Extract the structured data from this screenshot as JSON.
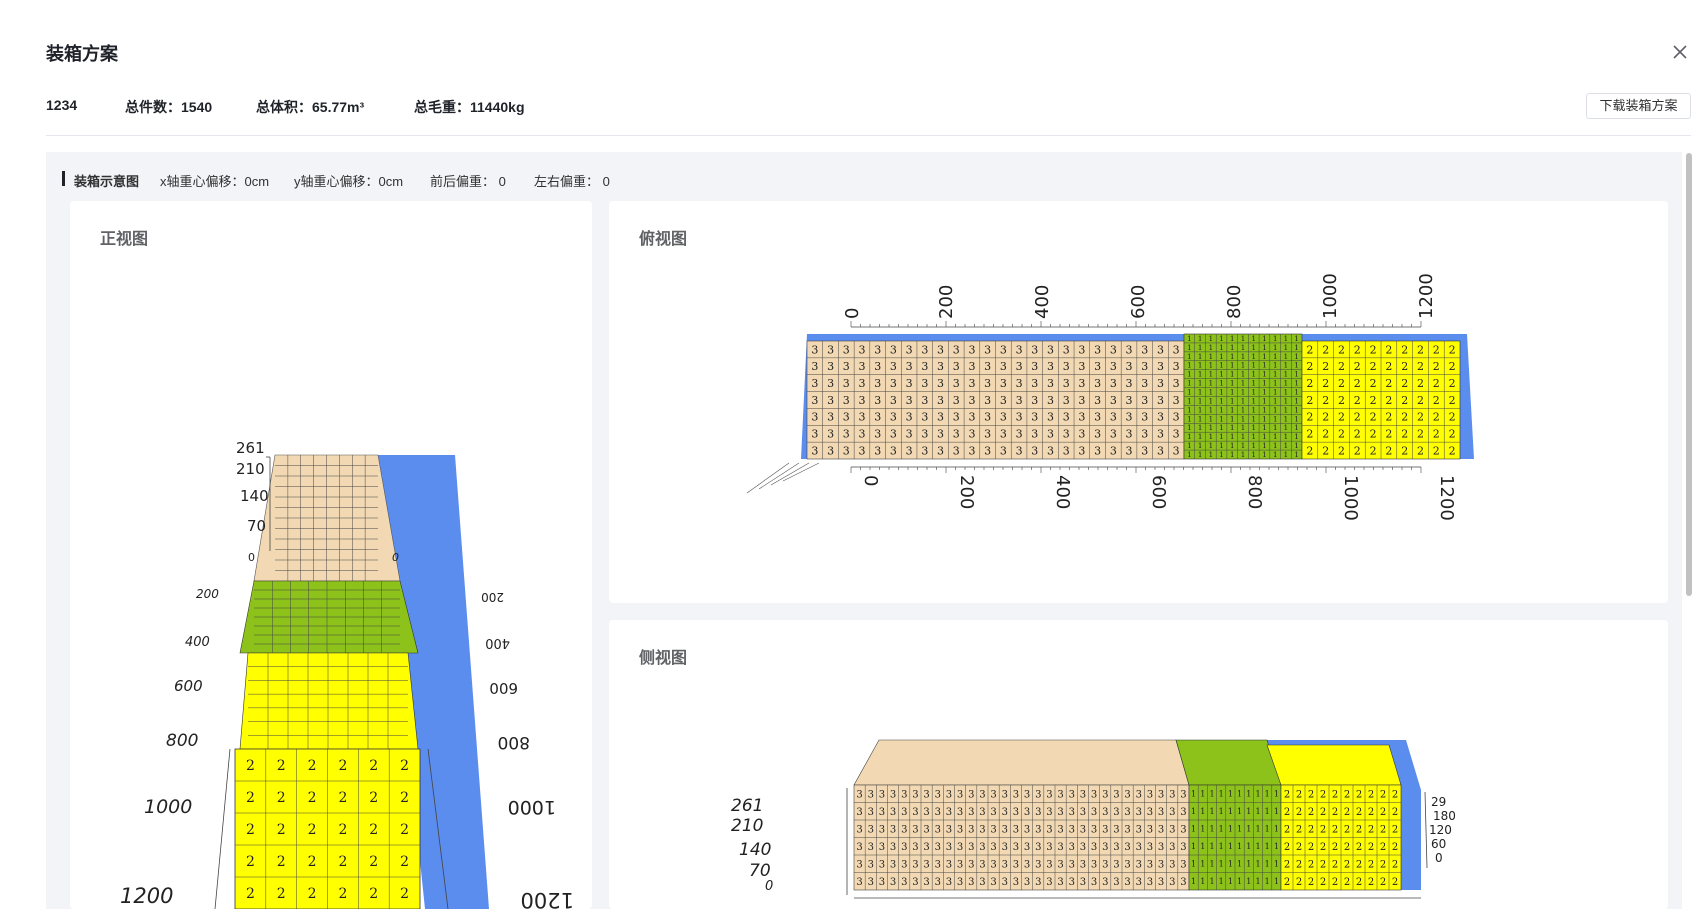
{
  "dialog": {
    "title": "装箱方案",
    "order_no": "1234",
    "total_count": "总件数：1540",
    "total_volume": "总体积：65.77m³",
    "total_weight": "总毛重：11440kg",
    "download_label": "下载装箱方案"
  },
  "diagram": {
    "heading": "装箱示意图",
    "x_offset": "x轴重心偏移：0cm",
    "y_offset": "y轴重心偏移：0cm",
    "front_back": "前后偏重：  0",
    "left_right": "左右偏重：  0"
  },
  "views": {
    "front": {
      "title": "正视图",
      "height_ticks": [
        "261",
        "210",
        "140",
        "70",
        "0"
      ],
      "length_ticks": [
        "0",
        "200",
        "400",
        "600",
        "800",
        "1000",
        "1200"
      ]
    },
    "top": {
      "title": "俯视图",
      "length_ticks": [
        "0",
        "200",
        "400",
        "600",
        "800",
        "1000",
        "1200"
      ]
    },
    "side": {
      "title": "侧视图",
      "height_ticks": [
        "261",
        "210",
        "140",
        "70",
        "0"
      ],
      "width_ticks": [
        "29",
        "180",
        "120",
        "60",
        "0"
      ]
    }
  },
  "cargo": [
    {
      "label": "3",
      "color": "#f2d9b3"
    },
    {
      "label": "1",
      "color": "#8cc21a"
    },
    {
      "label": "2",
      "color": "#ffff00"
    }
  ],
  "container_color": "#5b8def"
}
